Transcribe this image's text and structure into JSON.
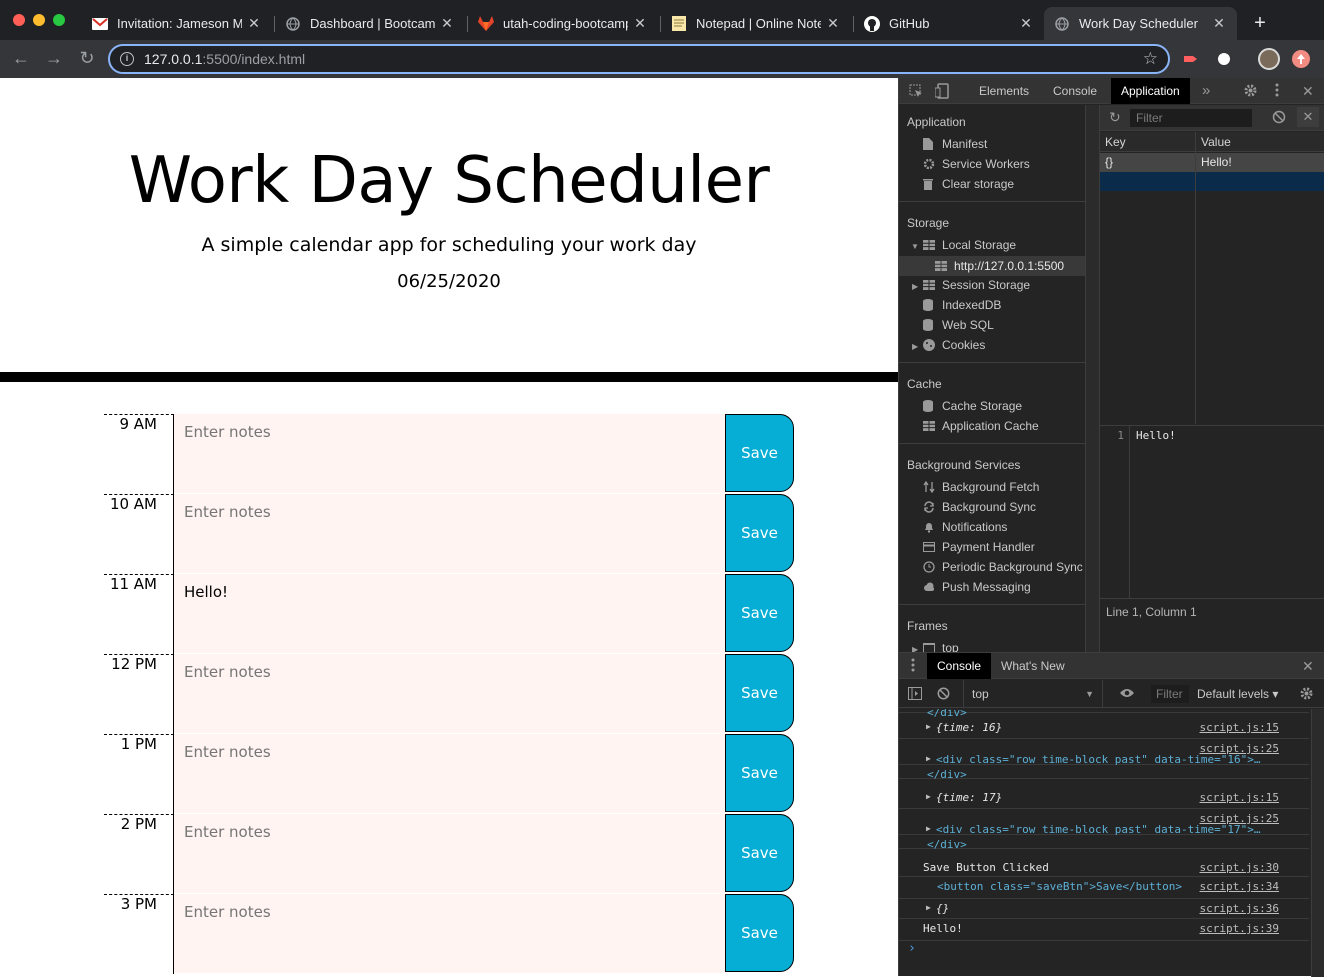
{
  "browser": {
    "tabs": [
      {
        "title": "Invitation: Jameson Mi",
        "icon": "gmail-icon"
      },
      {
        "title": "Dashboard | Bootcamp",
        "icon": "globe-icon"
      },
      {
        "title": "utah-coding-bootcamp",
        "icon": "gitlab-icon"
      },
      {
        "title": "Notepad | Online Notes",
        "icon": "notepad-icon"
      },
      {
        "title": "GitHub",
        "icon": "github-icon"
      },
      {
        "title": "Work Day Scheduler",
        "icon": "globe-icon"
      }
    ],
    "tab_close": "✕",
    "new_tab": "+",
    "url_host": "127.0.0.1",
    "url_path": ":5500/index.html",
    "star": "☆",
    "back": "←",
    "forward": "→",
    "reload": "↻",
    "info": "i"
  },
  "page": {
    "title": "Work Day Scheduler",
    "lead": "A simple calendar app for scheduling your work day",
    "date": "06/25/2020",
    "placeholder": "Enter notes",
    "save_label": "Save",
    "rows": [
      {
        "hour": "9 AM",
        "note": ""
      },
      {
        "hour": "10 AM",
        "note": ""
      },
      {
        "hour": "11 AM",
        "note": "Hello!"
      },
      {
        "hour": "12 PM",
        "note": ""
      },
      {
        "hour": "1 PM",
        "note": ""
      },
      {
        "hour": "2 PM",
        "note": ""
      },
      {
        "hour": "3 PM",
        "note": ""
      }
    ],
    "colors": {
      "past_bg": "#fff4f2",
      "save_bg": "#06aed5"
    }
  },
  "devtools": {
    "tabs": [
      "Elements",
      "Console",
      "Application"
    ],
    "active_tab": "Application",
    "more": "»",
    "close": "✕",
    "sidebar": {
      "application_head": "Application",
      "application_items": [
        "Manifest",
        "Service Workers",
        "Clear storage"
      ],
      "storage_head": "Storage",
      "storage_items": [
        "Local Storage",
        "http://127.0.0.1:5500",
        "Session Storage",
        "IndexedDB",
        "Web SQL",
        "Cookies"
      ],
      "cache_head": "Cache",
      "cache_items": [
        "Cache Storage",
        "Application Cache"
      ],
      "bg_head": "Background Services",
      "bg_items": [
        "Background Fetch",
        "Background Sync",
        "Notifications",
        "Payment Handler",
        "Periodic Background Sync",
        "Push Messaging"
      ],
      "frames_head": "Frames",
      "frames_items": [
        "top"
      ]
    },
    "storage": {
      "filter_placeholder": "Filter",
      "key_header": "Key",
      "value_header": "Value",
      "rows": [
        {
          "key": "{}",
          "value": "Hello!"
        }
      ],
      "preview_line_no": "1",
      "preview_text": "Hello!",
      "status": "Line 1, Column 1"
    },
    "drawer": {
      "tabs": [
        "Console",
        "What's New"
      ],
      "active_tab": "Console",
      "context": "top",
      "filter_placeholder": "Filter",
      "levels": "Default levels ▾",
      "lines": [
        {
          "text": "</div>",
          "src": ""
        },
        {
          "text": "{time: 16}",
          "src": "script.js:15"
        },
        {
          "text": "<div class=\"row time-block past\" data-time=\"16\">…",
          "src": "script.js:25"
        },
        {
          "text": "</div>",
          "src": ""
        },
        {
          "text": "{time: 17}",
          "src": "script.js:15"
        },
        {
          "text": "<div class=\"row time-block past\" data-time=\"17\">…",
          "src": "script.js:25"
        },
        {
          "text": "</div>",
          "src": ""
        },
        {
          "text": "Save Button Clicked",
          "src": "script.js:30"
        },
        {
          "text": "<button class=\"saveBtn\">Save</button>",
          "src": "script.js:34"
        },
        {
          "text": "{}",
          "src": "script.js:36"
        },
        {
          "text": "Hello!",
          "src": "script.js:39"
        }
      ],
      "prompt": "›"
    }
  }
}
